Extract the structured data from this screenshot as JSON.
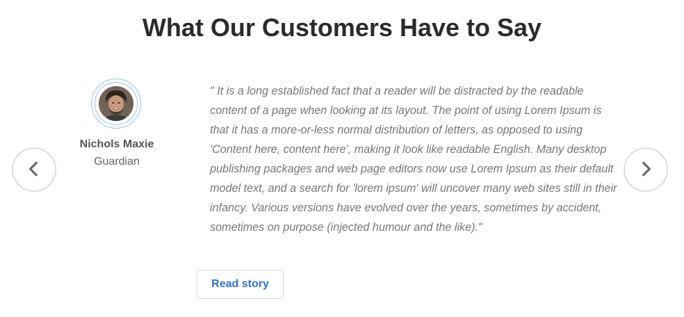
{
  "section": {
    "title": "What Our Customers Have to Say"
  },
  "testimonial": {
    "name": "Nichols Maxie",
    "role": "Guardian",
    "quote": "\" It is a long established fact that a reader will be distracted by the readable content of a page when looking at its layout. The point of using Lorem Ipsum is that it has a more-or-less normal distribution of letters, as opposed to using 'Content here, content here', making it look like readable English. Many desktop publishing packages and web page editors now use Lorem Ipsum as their default model text, and a search for 'lorem ipsum' will uncover many web sites still in their infancy. Various versions have evolved over the years, sometimes by accident, sometimes on purpose (injected humour and the like).\"",
    "read_label": "Read story"
  },
  "navigation": {
    "prev_icon": "chevron-left-icon",
    "next_icon": "chevron-right-icon"
  },
  "colors": {
    "heading": "#2b2b2b",
    "accent": "#2f6fd6",
    "ring": "#9bbfe8",
    "quote_text": "#777777"
  }
}
